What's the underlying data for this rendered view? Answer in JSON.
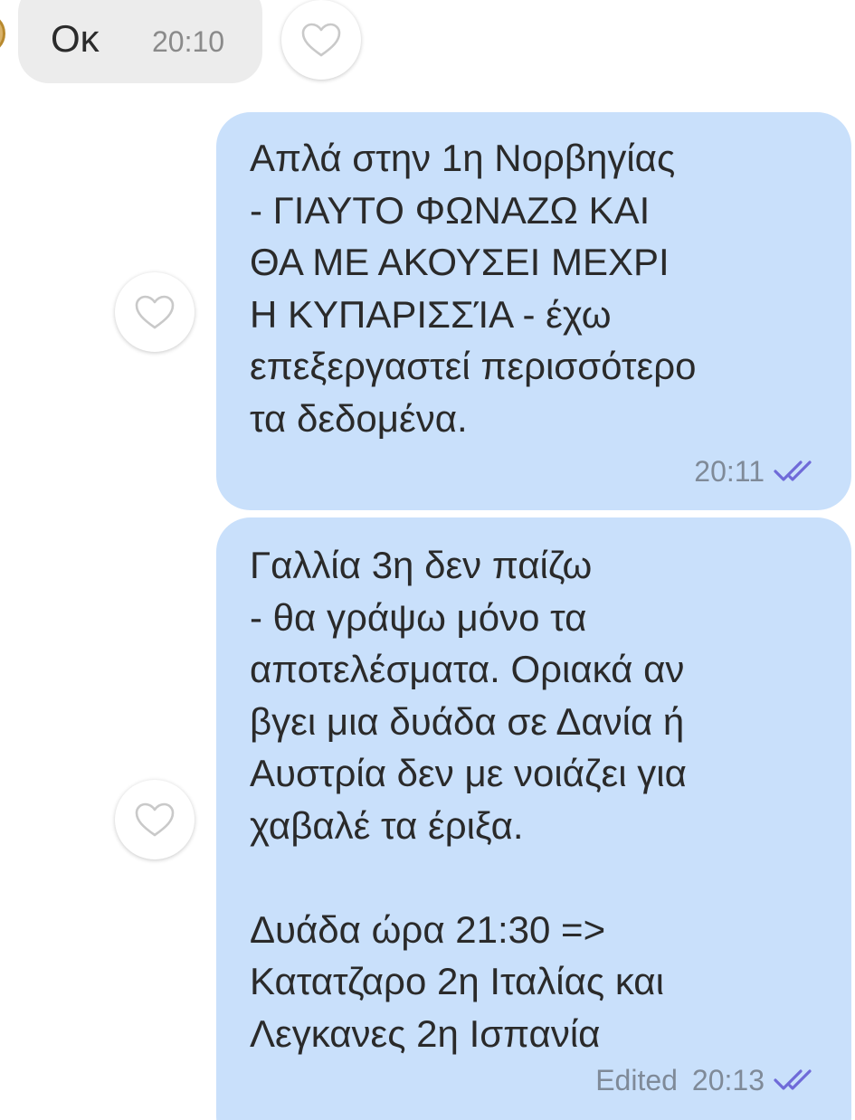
{
  "incoming": {
    "text": "Οκ",
    "time": "20:10"
  },
  "outgoing": [
    {
      "text": "Απλά στην 1η Νορβηγίας\n- ΓΙΑΥΤΟ ΦΩΝΑΖΩ ΚΑΙ\nΘΑ ΜΕ ΑΚΟΥΣΕΙ ΜΕΧΡΙ\nΗ ΚΥΠΑΡΙΣΣΊΑ - έχω\nεπεξεργαστεί περισσότερο\nτα δεδομένα.",
      "time": "20:11",
      "edited": "",
      "status_icon": "double-check-icon"
    },
    {
      "text": "Γαλλία 3η δεν παίζω\n- θα γράψω μόνο τα\nαποτελέσματα. Οριακά αν\nβγει μια δυάδα σε Δανία ή\nΑυστρία δεν με νοιάζει για\nχαβαλέ τα έριξα.\n\nΔυάδα ώρα 21:30 =>\nΚατατζαρο 2η Ιταλίας και\nΛεγκανες 2η Ισπανία",
      "time": "20:13",
      "edited": "Edited",
      "status_icon": "double-check-icon"
    }
  ],
  "icons": {
    "like": "heart-outline-icon",
    "read": "double-check-icon"
  },
  "colors": {
    "incoming_bubble": "#ececec",
    "outgoing_bubble": "#c9e0fb",
    "read_check": "#6f6ad8",
    "timestamp": "#7f8a98"
  }
}
